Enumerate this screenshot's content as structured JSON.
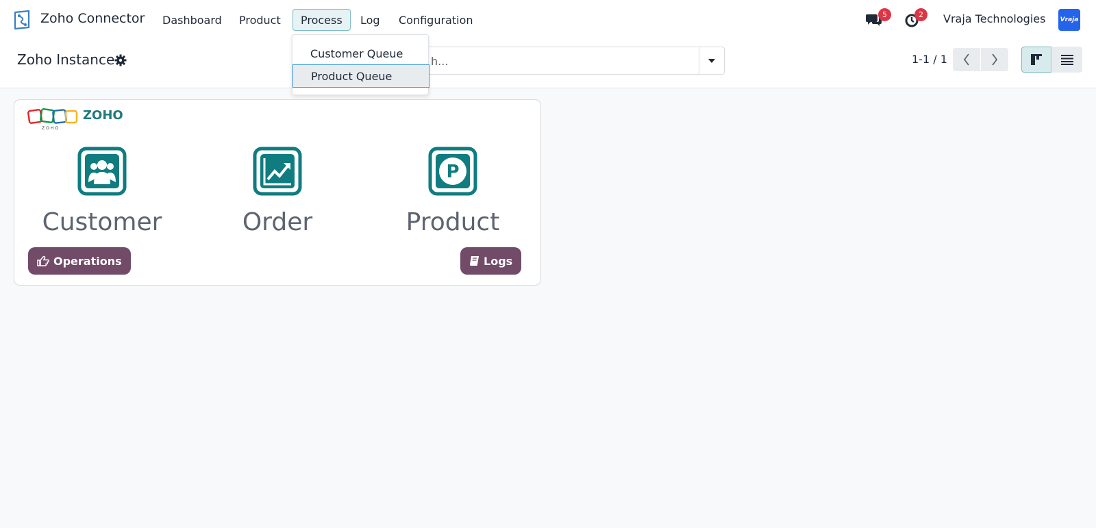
{
  "navbar": {
    "brand": "Zoho Connector",
    "menus": [
      "Dashboard",
      "Product",
      "Process",
      "Log",
      "Configuration"
    ],
    "messages_count": "5",
    "activities_count": "2",
    "company": "Vraja Technologies",
    "avatar_text": "Vraja"
  },
  "process_dropdown": {
    "items": [
      "Customer Queue",
      "Product Queue"
    ]
  },
  "control_panel": {
    "title": "Zoho Instance",
    "search_placeholder_visible": "h...",
    "pager": "1-1 / 1"
  },
  "card": {
    "logo_text": "ZOHO",
    "tiles": [
      {
        "label": "Customer",
        "icon": "users-icon"
      },
      {
        "label": "Order",
        "icon": "chart-line-icon"
      },
      {
        "label": "Product",
        "icon": "product-p-icon"
      }
    ],
    "operations_label": "Operations",
    "logs_label": "Logs",
    "accent_color": "#0f7c80",
    "button_color": "#714b67"
  }
}
